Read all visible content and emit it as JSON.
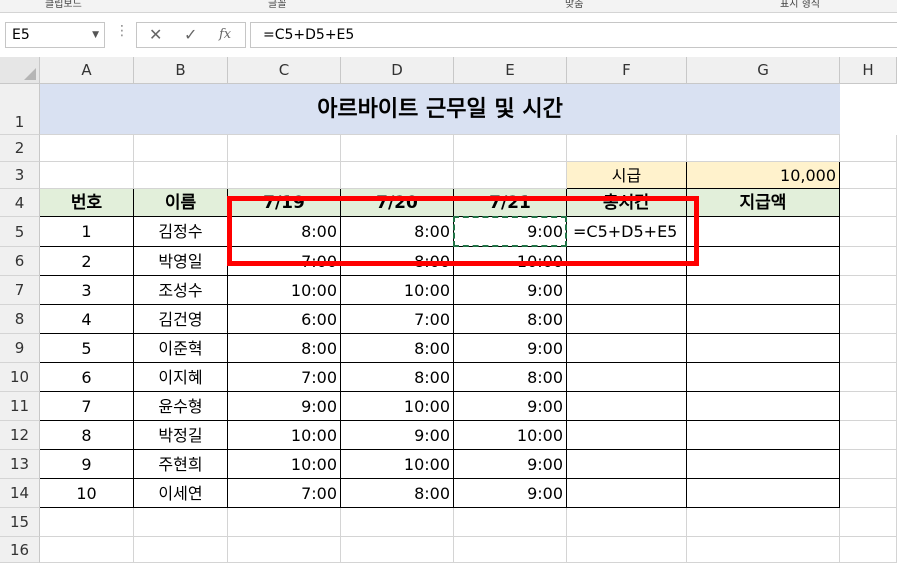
{
  "ribbon": {
    "labels": [
      "클립보드",
      "글꼴",
      "맞춤",
      "표시 형식"
    ]
  },
  "formula_bar": {
    "name_box": "E5",
    "formula": "=C5+D5+E5",
    "cancel_icon": "✕",
    "enter_icon": "✓",
    "fx_icon": "fx"
  },
  "columns": [
    "A",
    "B",
    "C",
    "D",
    "E",
    "F",
    "G",
    "H"
  ],
  "rows": [
    "1",
    "2",
    "3",
    "4",
    "5",
    "6",
    "7",
    "8",
    "9",
    "10",
    "11",
    "12",
    "13",
    "14",
    "15",
    "16"
  ],
  "sheet": {
    "title": "아르바이트 근무일 및 시간",
    "hourly_label": "시급",
    "hourly_value": "10,000",
    "headers": [
      "번호",
      "이름",
      "7/19",
      "7/20",
      "7/21",
      "총시간",
      "지급액"
    ],
    "formula_text": "=C5+D5+E5",
    "data": [
      [
        "1",
        "김정수",
        "8:00",
        "8:00",
        "9:00"
      ],
      [
        "2",
        "박영일",
        "7:00",
        "8:00",
        "10:00"
      ],
      [
        "3",
        "조성수",
        "10:00",
        "10:00",
        "9:00"
      ],
      [
        "4",
        "김건영",
        "6:00",
        "7:00",
        "8:00"
      ],
      [
        "5",
        "이준혁",
        "8:00",
        "8:00",
        "9:00"
      ],
      [
        "6",
        "이지혜",
        "7:00",
        "8:00",
        "8:00"
      ],
      [
        "7",
        "윤수형",
        "9:00",
        "10:00",
        "9:00"
      ],
      [
        "8",
        "박정길",
        "10:00",
        "9:00",
        "10:00"
      ],
      [
        "9",
        "주현희",
        "10:00",
        "10:00",
        "9:00"
      ],
      [
        "10",
        "이세연",
        "7:00",
        "8:00",
        "9:00"
      ]
    ]
  },
  "colors": {
    "title_bg": "#d9e1f2",
    "header_bg": "#e2efda",
    "hourly_bg": "#fff2cc",
    "annotation": "#ff0000",
    "selection": "#217346"
  }
}
